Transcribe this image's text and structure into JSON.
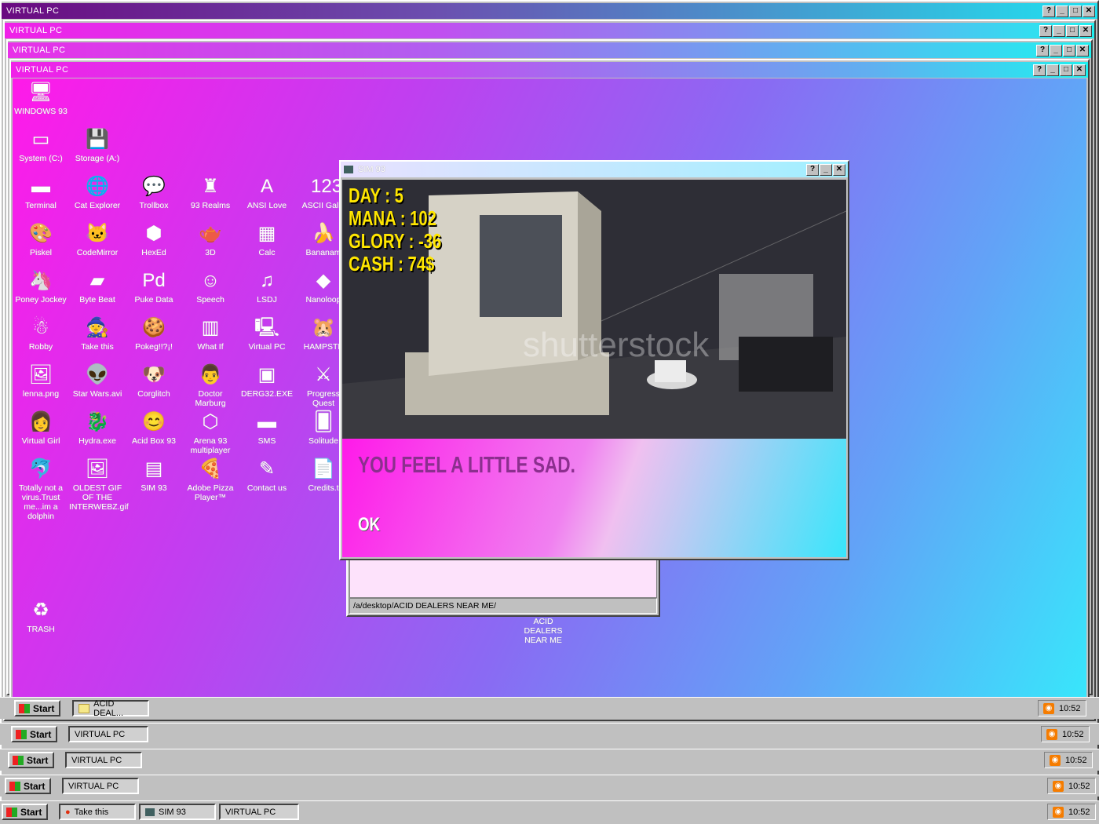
{
  "windows": [
    {
      "title": "VIRTUAL PC"
    },
    {
      "title": "VIRTUAL PC"
    },
    {
      "title": "VIRTUAL PC"
    },
    {
      "title": "VIRTUAL PC"
    }
  ],
  "controls": {
    "help": "?",
    "min": "_",
    "max": "□",
    "close": "✕"
  },
  "desktop_icons": [
    {
      "label": "WINDOWS 93",
      "icon": "computer-icon",
      "glyph": "🖥"
    },
    {
      "label": "System (C:)",
      "icon": "drive-icon",
      "glyph": "▭"
    },
    {
      "label": "Storage (A:)",
      "icon": "floppy-icon",
      "glyph": "💾"
    },
    {
      "label": "Terminal",
      "icon": "terminal-icon",
      "glyph": "▬"
    },
    {
      "label": "Cat Explorer",
      "icon": "globe-icon",
      "glyph": "🌐"
    },
    {
      "label": "Trollbox",
      "icon": "chat-icon",
      "glyph": "💬"
    },
    {
      "label": "93 Realms",
      "icon": "realms-icon",
      "glyph": "♜"
    },
    {
      "label": "ANSI Love",
      "icon": "ansi-icon",
      "glyph": "A"
    },
    {
      "label": "ASCII Galle",
      "icon": "ascii-icon",
      "glyph": "123"
    },
    {
      "label": "Piskel",
      "icon": "palette-icon",
      "glyph": "🎨"
    },
    {
      "label": "CodeMirror",
      "icon": "cat-icon",
      "glyph": "🐱"
    },
    {
      "label": "HexEd",
      "icon": "hex-icon",
      "glyph": "⬢"
    },
    {
      "label": "3D",
      "icon": "teapot-icon",
      "glyph": "🫖"
    },
    {
      "label": "Calc",
      "icon": "calc-icon",
      "glyph": "▦"
    },
    {
      "label": "Bananam",
      "icon": "banana-icon",
      "glyph": "🍌"
    },
    {
      "label": "Poney Jockey",
      "icon": "pony-icon",
      "glyph": "🦄"
    },
    {
      "label": "Byte Beat",
      "icon": "bytebeat-icon",
      "glyph": "▰"
    },
    {
      "label": "Puke Data",
      "icon": "pd-icon",
      "glyph": "Pd"
    },
    {
      "label": "Speech",
      "icon": "speech-icon",
      "glyph": "☺"
    },
    {
      "label": "LSDJ",
      "icon": "lsdj-icon",
      "glyph": "♫"
    },
    {
      "label": "Nanoloop",
      "icon": "nanoloop-icon",
      "glyph": "◆"
    },
    {
      "label": "Robby",
      "icon": "robby-icon",
      "glyph": "☃"
    },
    {
      "label": "Take this",
      "icon": "takethis-icon",
      "glyph": "🧙"
    },
    {
      "label": "Pokeg!!?¡!",
      "icon": "pokeg-icon",
      "glyph": "🍪"
    },
    {
      "label": "What If",
      "icon": "whatif-icon",
      "glyph": "▥"
    },
    {
      "label": "Virtual PC",
      "icon": "virtualpc-icon",
      "glyph": "🖳"
    },
    {
      "label": "HAMPSTE",
      "icon": "hamster-icon",
      "glyph": "🐹"
    },
    {
      "label": "lenna.png",
      "icon": "image-file-icon",
      "glyph": "🖼"
    },
    {
      "label": "Star Wars.avi",
      "icon": "yoda-icon",
      "glyph": "👽"
    },
    {
      "label": "Corglitch",
      "icon": "corgi-icon",
      "glyph": "🐶"
    },
    {
      "label": "Doctor Marburg",
      "icon": "doctor-icon",
      "glyph": "👨"
    },
    {
      "label": "DERG32.EXE",
      "icon": "derg-icon",
      "glyph": "▣"
    },
    {
      "label": "Progress Quest",
      "icon": "quest-icon",
      "glyph": "⚔"
    },
    {
      "label": "Virtual Girl",
      "icon": "face-icon",
      "glyph": "👩"
    },
    {
      "label": "Hydra.exe",
      "icon": "hydra-icon",
      "glyph": "🐉"
    },
    {
      "label": "Acid Box 93",
      "icon": "smiley-icon",
      "glyph": "😊"
    },
    {
      "label": "Arena 93 multiplayer",
      "icon": "cube-icon",
      "glyph": "⬡"
    },
    {
      "label": "SMS",
      "icon": "sms-icon",
      "glyph": "▬"
    },
    {
      "label": "Solitude",
      "icon": "solitude-icon",
      "glyph": "🂠"
    },
    {
      "label": "Totally not a virus.Trust me...im a dolphin",
      "icon": "dolphin-icon",
      "glyph": "🐬"
    },
    {
      "label": "OLDEST GIF OF THE INTERWEBZ.gif",
      "icon": "gif-file-icon",
      "glyph": "🖼"
    },
    {
      "label": "SIM 93",
      "icon": "sim93-icon",
      "glyph": "▤"
    },
    {
      "label": "Adobe Pizza Player™",
      "icon": "pizza-icon",
      "glyph": "🍕"
    },
    {
      "label": "Contact us",
      "icon": "contact-icon",
      "glyph": "✎"
    },
    {
      "label": "Credits.t",
      "icon": "text-file-icon",
      "glyph": "📄"
    },
    {
      "label": "TRASH",
      "icon": "trash-icon",
      "glyph": "♻"
    },
    {
      "label": "ACID DEALERS NEAR ME",
      "icon": "folder-icon",
      "glyph": "📁"
    }
  ],
  "explorer": {
    "path": "/a/desktop/ACID DEALERS NEAR ME/"
  },
  "sim": {
    "title": "SIM 93",
    "stats": [
      "DAY : 5",
      "MANA : 102",
      "GLORY : -36",
      "CASH : 74$"
    ],
    "watermark": "shutterstock",
    "message": "YOU FEEL A LITTLE SAD.",
    "ok": "OK"
  },
  "taskbars": [
    {
      "start": "Start",
      "buttons": [
        "ACID DEAL..."
      ],
      "clock": "10:52"
    },
    {
      "start": "Start",
      "buttons": [
        "VIRTUAL PC"
      ],
      "clock": "10:52"
    },
    {
      "start": "Start",
      "buttons": [
        "VIRTUAL PC"
      ],
      "clock": "10:52"
    },
    {
      "start": "Start",
      "buttons": [
        "VIRTUAL PC"
      ],
      "clock": "10:52"
    },
    {
      "start": "Start",
      "buttons": [
        "Take this",
        "SIM 93",
        "VIRTUAL PC"
      ],
      "clock": "10:52"
    }
  ]
}
